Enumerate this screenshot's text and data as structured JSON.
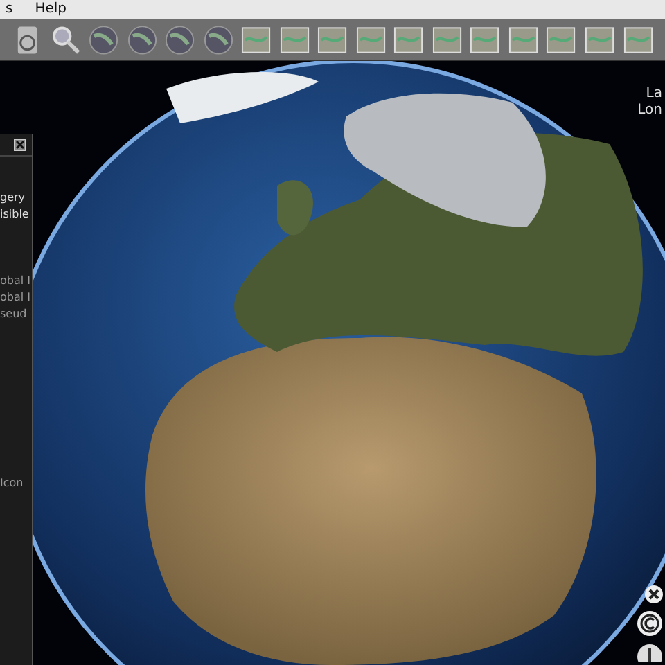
{
  "menu_bar": {
    "items": [
      "s",
      "Help"
    ]
  },
  "layer_panel": {
    "lines": [
      {
        "text": "gery",
        "kind": "plain"
      },
      {
        "text": "isible",
        "kind": "plain"
      },
      {
        "text": "obal I",
        "kind": "dim"
      },
      {
        "text": "obal I",
        "kind": "dim"
      },
      {
        "text": "seud",
        "kind": "dim"
      },
      {
        "text": "Icon",
        "kind": "dim"
      }
    ]
  },
  "position_readout": [
    "La",
    "Lon"
  ]
}
